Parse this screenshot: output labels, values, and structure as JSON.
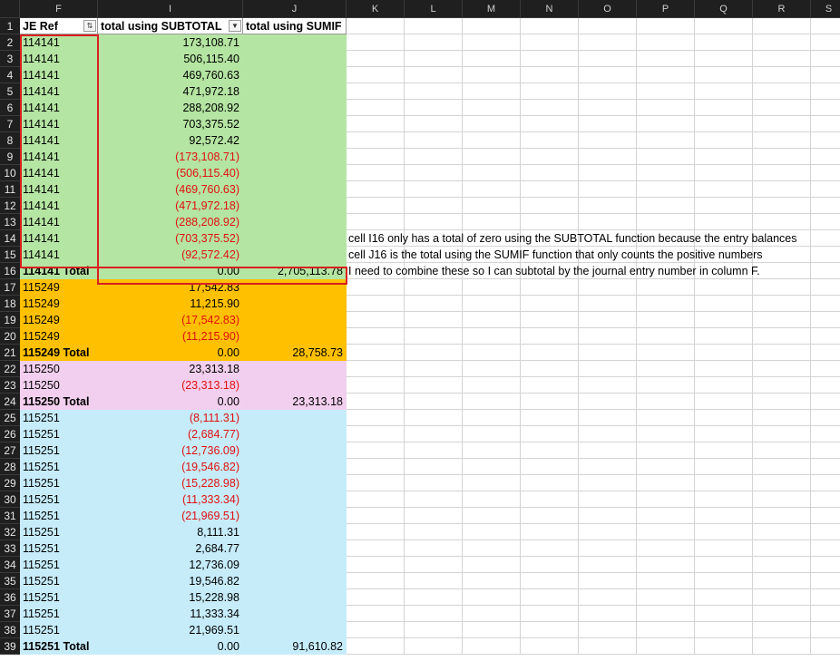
{
  "columns": [
    "F",
    "I",
    "J",
    "K",
    "L",
    "M",
    "N",
    "O",
    "P",
    "Q",
    "R",
    "S"
  ],
  "header": {
    "je_ref": "JE Ref",
    "subtotal": "total using SUBTOTAL",
    "sumif": "total using SUMIF"
  },
  "rows": [
    {
      "n": "1"
    },
    {
      "n": "2",
      "f": "114141",
      "i": "173,108.71",
      "g": "green"
    },
    {
      "n": "3",
      "f": "114141",
      "i": "506,115.40",
      "g": "green"
    },
    {
      "n": "4",
      "f": "114141",
      "i": "469,760.63",
      "g": "green"
    },
    {
      "n": "5",
      "f": "114141",
      "i": "471,972.18",
      "g": "green"
    },
    {
      "n": "6",
      "f": "114141",
      "i": "288,208.92",
      "g": "green"
    },
    {
      "n": "7",
      "f": "114141",
      "i": "703,375.52",
      "g": "green"
    },
    {
      "n": "8",
      "f": "114141",
      "i": "92,572.42",
      "g": "green"
    },
    {
      "n": "9",
      "f": "114141",
      "i": "(173,108.71)",
      "neg": true,
      "g": "green"
    },
    {
      "n": "10",
      "f": "114141",
      "i": "(506,115.40)",
      "neg": true,
      "g": "green"
    },
    {
      "n": "11",
      "f": "114141",
      "i": "(469,760.63)",
      "neg": true,
      "g": "green"
    },
    {
      "n": "12",
      "f": "114141",
      "i": "(471,972.18)",
      "neg": true,
      "g": "green"
    },
    {
      "n": "13",
      "f": "114141",
      "i": "(288,208.92)",
      "neg": true,
      "g": "green"
    },
    {
      "n": "14",
      "f": "114141",
      "i": "(703,375.52)",
      "neg": true,
      "g": "green"
    },
    {
      "n": "15",
      "f": "114141",
      "i": "(92,572.42)",
      "neg": true,
      "g": "green"
    },
    {
      "n": "16",
      "f": "114141 Total",
      "i": "0.00",
      "j": "2,705,113.78",
      "total": true,
      "g": "green"
    },
    {
      "n": "17",
      "f": "115249",
      "i": "17,542.83",
      "g": "orange"
    },
    {
      "n": "18",
      "f": "115249",
      "i": "11,215.90",
      "g": "orange"
    },
    {
      "n": "19",
      "f": "115249",
      "i": "(17,542.83)",
      "neg": true,
      "g": "orange"
    },
    {
      "n": "20",
      "f": "115249",
      "i": "(11,215.90)",
      "neg": true,
      "g": "orange"
    },
    {
      "n": "21",
      "f": "115249 Total",
      "i": "0.00",
      "j": "28,758.73",
      "total": true,
      "g": "orange"
    },
    {
      "n": "22",
      "f": "115250",
      "i": "23,313.18",
      "g": "pink"
    },
    {
      "n": "23",
      "f": "115250",
      "i": "(23,313.18)",
      "neg": true,
      "g": "pink"
    },
    {
      "n": "24",
      "f": "115250 Total",
      "i": "0.00",
      "j": "23,313.18",
      "total": true,
      "g": "pink"
    },
    {
      "n": "25",
      "f": "115251",
      "i": "(8,111.31)",
      "neg": true,
      "g": "blue"
    },
    {
      "n": "26",
      "f": "115251",
      "i": "(2,684.77)",
      "neg": true,
      "g": "blue"
    },
    {
      "n": "27",
      "f": "115251",
      "i": "(12,736.09)",
      "neg": true,
      "g": "blue"
    },
    {
      "n": "28",
      "f": "115251",
      "i": "(19,546.82)",
      "neg": true,
      "g": "blue"
    },
    {
      "n": "29",
      "f": "115251",
      "i": "(15,228.98)",
      "neg": true,
      "g": "blue"
    },
    {
      "n": "30",
      "f": "115251",
      "i": "(11,333.34)",
      "neg": true,
      "g": "blue"
    },
    {
      "n": "31",
      "f": "115251",
      "i": "(21,969.51)",
      "neg": true,
      "g": "blue"
    },
    {
      "n": "32",
      "f": "115251",
      "i": "8,111.31",
      "g": "blue"
    },
    {
      "n": "33",
      "f": "115251",
      "i": "2,684.77",
      "g": "blue"
    },
    {
      "n": "34",
      "f": "115251",
      "i": "12,736.09",
      "g": "blue"
    },
    {
      "n": "35",
      "f": "115251",
      "i": "19,546.82",
      "g": "blue"
    },
    {
      "n": "36",
      "f": "115251",
      "i": "15,228.98",
      "g": "blue"
    },
    {
      "n": "37",
      "f": "115251",
      "i": "11,333.34",
      "g": "blue"
    },
    {
      "n": "38",
      "f": "115251",
      "i": "21,969.51",
      "g": "blue"
    },
    {
      "n": "39",
      "f": "115251 Total",
      "i": "0.00",
      "j": "91,610.82",
      "total": true,
      "g": "blue"
    }
  ],
  "notes": [
    {
      "row": 14,
      "text": "cell I16 only has a total of zero using the SUBTOTAL function because the entry balances"
    },
    {
      "row": 15,
      "text": "cell J16 is the total using the SUMIF function that only counts the positive numbers"
    },
    {
      "row": 16,
      "text": "I need to combine these so I can subtotal by the journal entry number in column F."
    }
  ],
  "colors": {
    "green": "#b4e5a2",
    "orange": "#ffc000",
    "pink": "#f2cfee",
    "blue": "#c6ecfa",
    "negative": "#e01010",
    "highlight_border": "#d92020"
  },
  "icons": {
    "je_ref_filter": "filter-sort-icon",
    "subtotal_filter": "dropdown-arrow-icon"
  }
}
